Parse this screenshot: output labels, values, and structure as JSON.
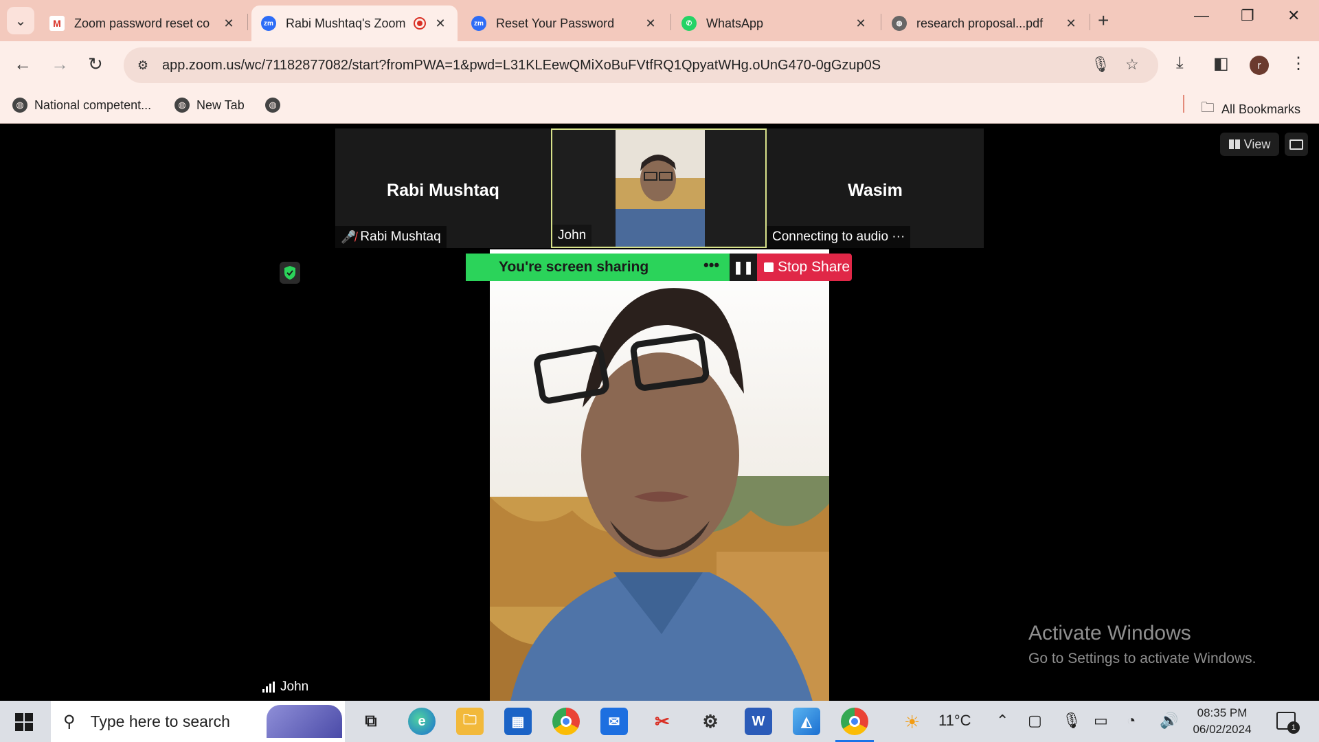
{
  "browser": {
    "tabs": [
      {
        "label": "Zoom password reset co",
        "favicon": "gmail-icon",
        "active": false
      },
      {
        "label": "Rabi Mushtaq's Zoom",
        "favicon": "zoom-icon",
        "active": true,
        "recording": true
      },
      {
        "label": "Reset Your Password",
        "favicon": "zoom-icon",
        "active": false
      },
      {
        "label": "WhatsApp",
        "favicon": "whatsapp-icon",
        "active": false
      },
      {
        "label": "research proposal...pdf",
        "favicon": "globe-icon",
        "active": false
      }
    ],
    "url": "app.zoom.us/wc/71182877082/start?fromPWA=1&pwd=L31KLEewQMiXoBuFVtfRQ1QpyatWHg.oUnG470-0gGzup0S",
    "profile_initial": "r",
    "bookmarks": [
      {
        "label": "National competent..."
      },
      {
        "label": "New Tab"
      },
      {
        "label": ""
      }
    ],
    "all_bookmarks": "All Bookmarks"
  },
  "zoom": {
    "participants": [
      {
        "big_name": "Rabi Mushtaq",
        "tag": "Rabi Mushtaq",
        "muted": true
      },
      {
        "big_name": "",
        "tag": "John",
        "active_speaker": true
      },
      {
        "big_name": "Wasim",
        "tag": "Connecting to audio ···"
      }
    ],
    "view_label": "View",
    "share_status": "You're screen sharing",
    "stop_share_label": "Stop Share",
    "main_video_name": "John"
  },
  "watermark": {
    "line1": "Activate Windows",
    "line2": "Go to Settings to activate Windows."
  },
  "taskbar": {
    "search_placeholder": "Type here to search",
    "weather": "11°C",
    "time": "08:35 PM",
    "date": "06/02/2024",
    "notification_count": "1"
  },
  "colors": {
    "chrome_tabbar": "#f3c9bd",
    "chrome_toolbar": "#fdeee9",
    "share_green": "#2bd35a",
    "stop_red": "#e02747"
  }
}
